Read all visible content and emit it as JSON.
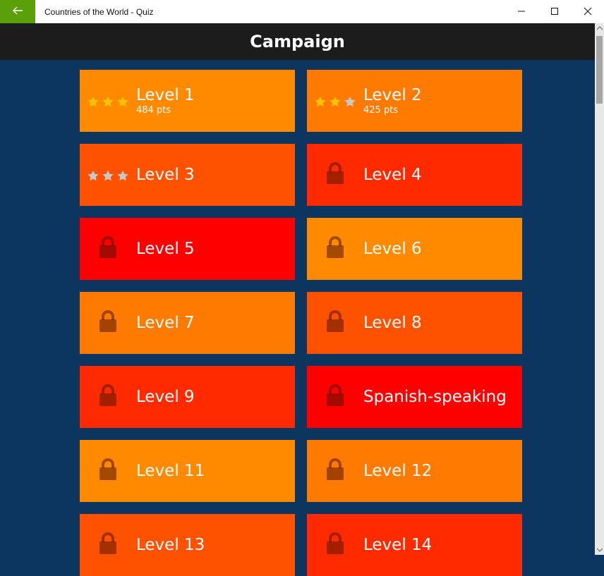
{
  "window": {
    "title": "Countries of the World - Quiz",
    "accent_color": "#5aa00a",
    "back_icon": "arrow-left-icon",
    "controls": [
      "minimize-icon",
      "maximize-icon",
      "close-icon"
    ]
  },
  "header": {
    "title": "Campaign"
  },
  "colors": {
    "background": "#0c3560",
    "header": "#1c1c1c",
    "star_gold": "#f5c400",
    "star_empty": "#c8c8c8"
  },
  "levels": [
    {
      "label": "Level 1",
      "pts": "484 pts",
      "locked": false,
      "stars": 3,
      "color": "#ff8a00"
    },
    {
      "label": "Level 2",
      "pts": "425 pts",
      "locked": false,
      "stars": 2,
      "color": "#ff7a00"
    },
    {
      "label": "Level 3",
      "pts": "",
      "locked": false,
      "stars": 0,
      "color": "#ff5200"
    },
    {
      "label": "Level 4",
      "pts": "",
      "locked": true,
      "stars": 0,
      "color": "#ff2a00"
    },
    {
      "label": "Level 5",
      "pts": "",
      "locked": true,
      "stars": 0,
      "color": "#ff0000"
    },
    {
      "label": "Level 6",
      "pts": "",
      "locked": true,
      "stars": 0,
      "color": "#ff8a00"
    },
    {
      "label": "Level 7",
      "pts": "",
      "locked": true,
      "stars": 0,
      "color": "#ff7a00"
    },
    {
      "label": "Level 8",
      "pts": "",
      "locked": true,
      "stars": 0,
      "color": "#ff5200"
    },
    {
      "label": "Level 9",
      "pts": "",
      "locked": true,
      "stars": 0,
      "color": "#ff2a00"
    },
    {
      "label": "Spanish-speaking",
      "pts": "",
      "locked": true,
      "stars": 0,
      "color": "#ff0000"
    },
    {
      "label": "Level 11",
      "pts": "",
      "locked": true,
      "stars": 0,
      "color": "#ff8a00"
    },
    {
      "label": "Level 12",
      "pts": "",
      "locked": true,
      "stars": 0,
      "color": "#ff7a00"
    },
    {
      "label": "Level 13",
      "pts": "",
      "locked": true,
      "stars": 0,
      "color": "#ff5200"
    },
    {
      "label": "Level 14",
      "pts": "",
      "locked": true,
      "stars": 0,
      "color": "#ff2a00"
    }
  ]
}
